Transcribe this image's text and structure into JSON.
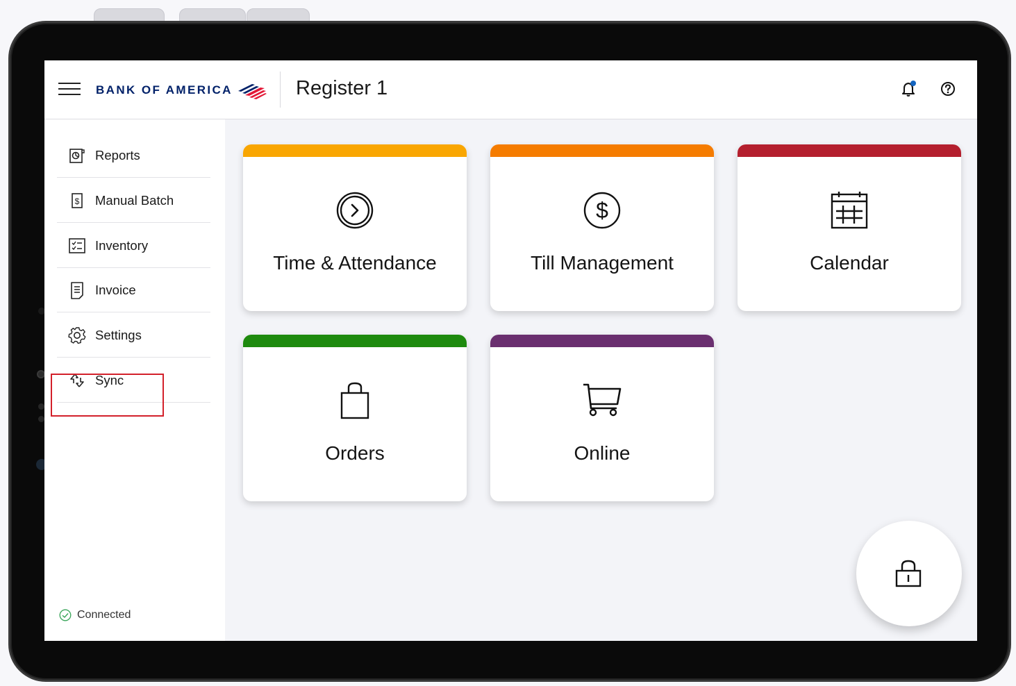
{
  "header": {
    "logo_text": "BANK OF AMERICA",
    "title": "Register 1",
    "icons": [
      "menu-icon",
      "bell-icon",
      "help-icon"
    ],
    "colors": {
      "brand_navy": "#012169",
      "brand_red": "#e31837"
    }
  },
  "sidebar": {
    "items": [
      {
        "label": "Reports",
        "icon": "reports-icon"
      },
      {
        "label": "Manual Batch",
        "icon": "manual-batch-icon"
      },
      {
        "label": "Inventory",
        "icon": "inventory-icon"
      },
      {
        "label": "Invoice",
        "icon": "invoice-icon"
      },
      {
        "label": "Settings",
        "icon": "gear-icon",
        "highlighted": true
      },
      {
        "label": "Sync",
        "icon": "sync-icon"
      }
    ],
    "status": {
      "label": "Connected",
      "icon": "check-circle-icon",
      "color": "#3aa55a"
    }
  },
  "tiles": [
    {
      "label": "Time & Attendance",
      "icon": "clock-icon",
      "color": "#f9a602"
    },
    {
      "label": "Till Management",
      "icon": "dollar-icon",
      "color": "#f57c00"
    },
    {
      "label": "Calendar",
      "icon": "calendar-icon",
      "color": "#b41f2e"
    },
    {
      "label": "Orders",
      "icon": "shopping-bag-icon",
      "color": "#1e8a0e"
    },
    {
      "label": "Online",
      "icon": "cart-icon",
      "color": "#6a2f6f"
    }
  ],
  "fab": {
    "icon": "lock-icon"
  },
  "highlight_color": "#d3202a"
}
